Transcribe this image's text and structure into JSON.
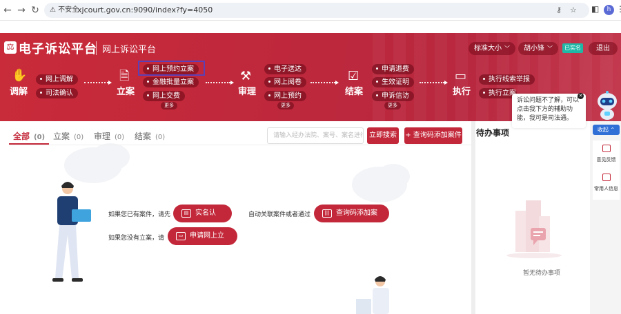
{
  "browser": {
    "security_label": "不安全",
    "url": "xjcourt.gov.cn:9090/index?fy=4050",
    "profile_initial": "h"
  },
  "header": {
    "site_title": "电子诉讼平台",
    "subtitle": "网上诉讼平台",
    "font_size_label": "标准大小",
    "user_name": "胡小锋",
    "verified_badge": "已实名",
    "logout_label": "退出"
  },
  "flow": {
    "stages": [
      {
        "label": "调解",
        "icon": "handshake-icon",
        "items": [
          "网上调解",
          "司法确认"
        ],
        "more": ""
      },
      {
        "label": "立案",
        "icon": "file-icon",
        "items": [
          "网上预约立案",
          "金融批量立案",
          "网上交费"
        ],
        "more": "更多"
      },
      {
        "label": "审理",
        "icon": "gavel-icon",
        "items": [
          "电子送达",
          "网上阅卷",
          "网上预约"
        ],
        "more": "更多"
      },
      {
        "label": "结案",
        "icon": "document-check-icon",
        "items": [
          "申请退费",
          "生效证明",
          "申诉信访"
        ],
        "more": "更多"
      },
      {
        "label": "执行",
        "icon": "monitor-icon",
        "items": [
          "执行线索举报",
          "执行立案"
        ],
        "more": ""
      }
    ]
  },
  "tabs": [
    {
      "label": "全部",
      "count": "(0)"
    },
    {
      "label": "立案",
      "count": "(0)"
    },
    {
      "label": "审理",
      "count": "(0)"
    },
    {
      "label": "结案",
      "count": "(0)"
    }
  ],
  "search": {
    "placeholder": "请输入经办法院、案号、案名进行搜索",
    "search_button": "立即搜索",
    "add_button": "+ 查询码添加案件"
  },
  "prompts": {
    "line1": "如果您已有案件，请先",
    "verify_button": "实名认证",
    "line1b": "自动关联案件或者通过",
    "query_button": "查询码添加案件",
    "line2": "如果您没有立案，请",
    "apply_button": "申请网上立案"
  },
  "todo": {
    "title": "待办事项",
    "empty": "暂无待办事项"
  },
  "assistant": {
    "bubble_text": "诉讼问题不了解，可以点击我下方的辅助功能，我可是司法通。",
    "collapse_label": "收起",
    "feedback_label": "意见反馈",
    "contacts_label": "常用人信息"
  }
}
